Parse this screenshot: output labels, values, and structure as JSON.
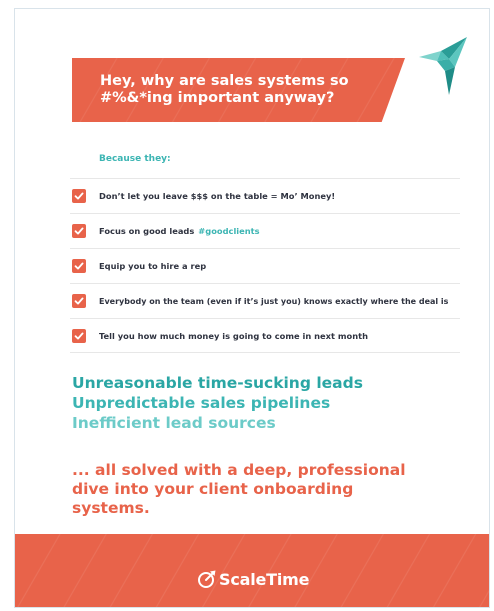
{
  "banner": {
    "title": "Hey, why are sales systems so #%&*ing important anyway?"
  },
  "intro": {
    "label": "Because they:"
  },
  "checklist": [
    {
      "text": "Don’t let you leave $$$ on the table = Mo’ Money!",
      "tag": ""
    },
    {
      "text": "Focus on good leads",
      "tag": "#goodclients"
    },
    {
      "text": "Equip you to hire a rep",
      "tag": ""
    },
    {
      "text": "Everybody on the team (even if it’s just you) knows exactly where the deal is",
      "tag": ""
    },
    {
      "text": "Tell you how much money is going to come in next month",
      "tag": ""
    }
  ],
  "pain_points": [
    "Unreasonable time-sucking leads",
    "Unpredictable sales pipelines",
    "Inefficient lead sources"
  ],
  "solution": {
    "text": "... all solved with a deep, professional dive into your client onboarding systems."
  },
  "footer": {
    "logo_text": "ScaleTime"
  },
  "colors": {
    "accent_orange": "#e8634a",
    "accent_teal": "#3cb5b3",
    "text_dark": "#2f3340"
  },
  "icons": {
    "bird": "origami-bird-icon",
    "check": "check-icon",
    "logo": "scaletime-logo-icon"
  }
}
